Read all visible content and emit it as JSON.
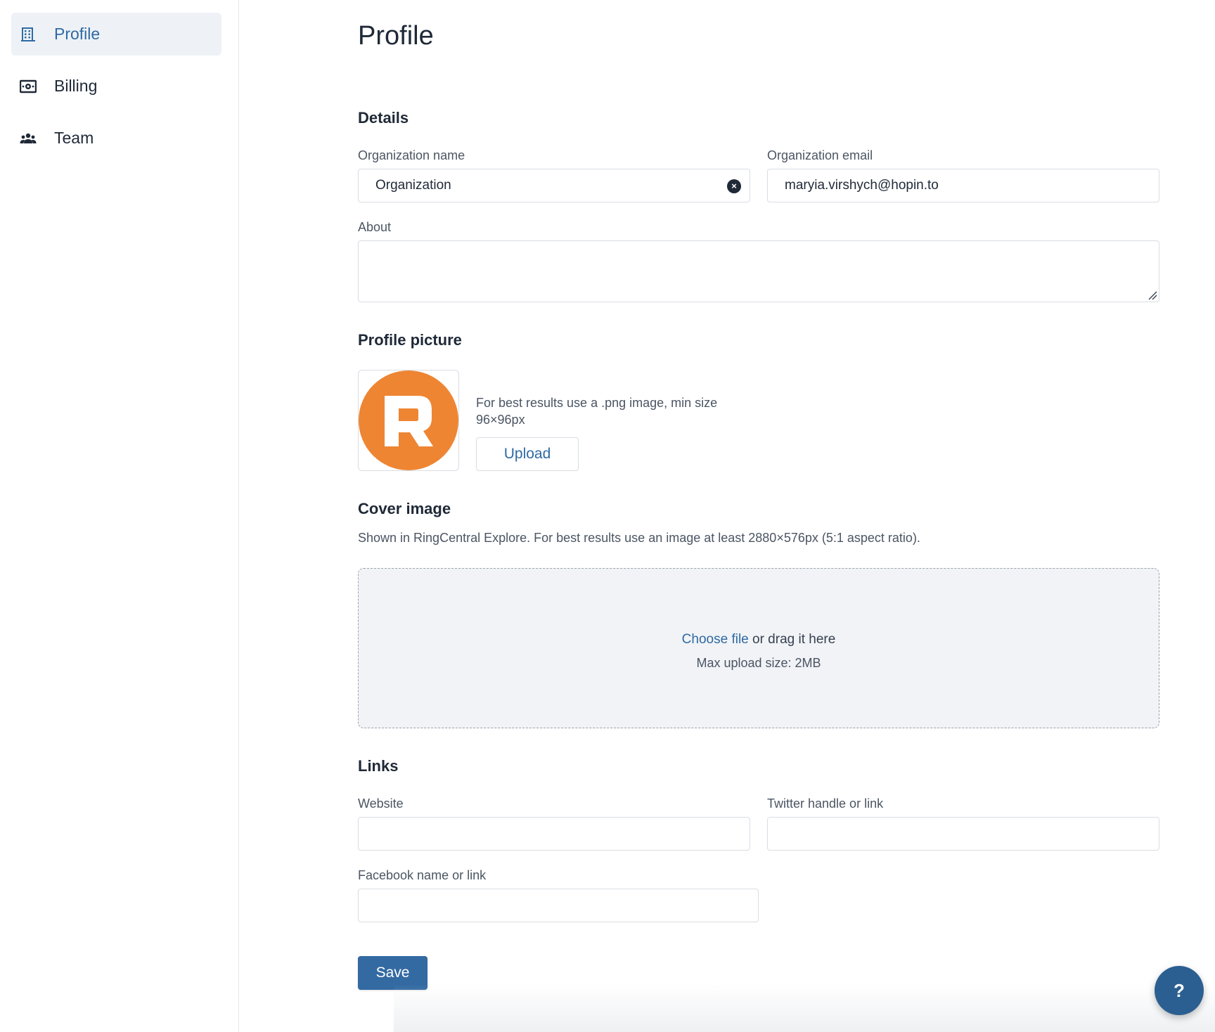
{
  "sidebar": {
    "items": [
      {
        "label": "Profile",
        "icon": "building-icon",
        "active": true
      },
      {
        "label": "Billing",
        "icon": "money-icon",
        "active": false
      },
      {
        "label": "Team",
        "icon": "team-icon",
        "active": false
      }
    ]
  },
  "page": {
    "title": "Profile"
  },
  "details": {
    "title": "Details",
    "org_name_label": "Organization name",
    "org_name_value": "Organization",
    "org_email_label": "Organization email",
    "org_email_value": "maryia.virshych@hopin.to",
    "about_label": "About",
    "about_value": ""
  },
  "profile_picture": {
    "title": "Profile picture",
    "hint": "For best results use a .png image, min size 96×96px",
    "upload_label": "Upload",
    "avatar_color": "#ee8533"
  },
  "cover_image": {
    "title": "Cover image",
    "description": "Shown in RingCentral Explore. For best results use an image at least 2880×576px (5:1 aspect ratio).",
    "choose_file": "Choose file",
    "drag_text": " or drag it here",
    "max_size": "Max upload size: 2MB"
  },
  "links": {
    "title": "Links",
    "website_label": "Website",
    "website_value": "",
    "twitter_label": "Twitter handle or link",
    "twitter_value": "",
    "facebook_label": "Facebook name or link",
    "facebook_value": ""
  },
  "actions": {
    "save_label": "Save",
    "help_label": "?"
  },
  "colors": {
    "accent": "#2f6aa3",
    "primary_button": "#336aa2",
    "fab": "#2c5f91"
  }
}
